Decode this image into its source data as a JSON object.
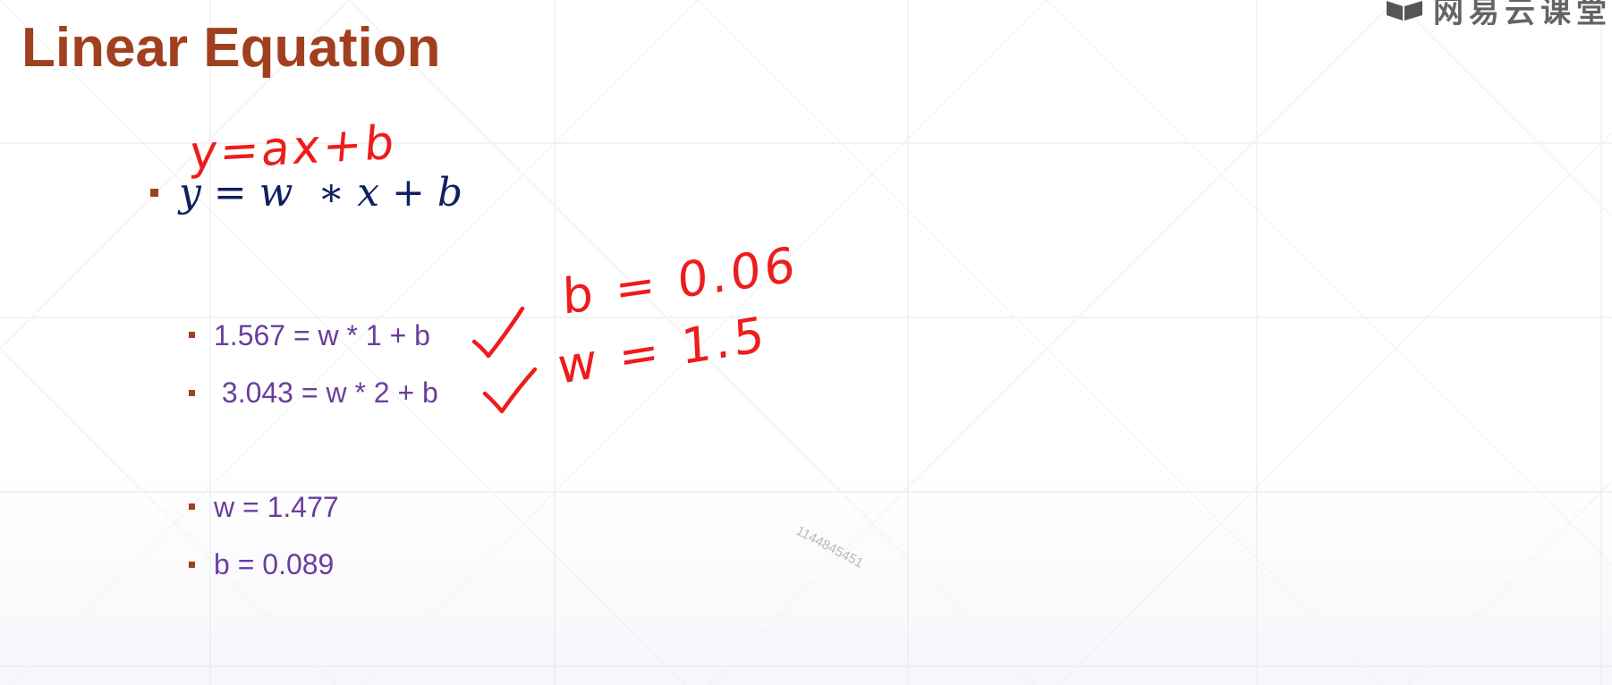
{
  "slide": {
    "title": "Linear Equation",
    "main_equation": "y = w  ∗ x + b",
    "items": [
      {
        "text": "1.567 = w * 1 + b"
      },
      {
        "text": " 3.043 = w * 2 + b"
      },
      {
        "text": "w = 1.477"
      },
      {
        "text": "b = 0.089"
      }
    ]
  },
  "annotations": {
    "handwritten_equation": "y=ax+b",
    "handwritten_b": "b = 0.06",
    "handwritten_w": "w = 1.5",
    "checkmark_count": 2
  },
  "overlay": {
    "watermark_id": "1144845451",
    "brand_name": "网易云课堂"
  },
  "colors": {
    "title": "#a0401f",
    "bullet": "#a0401f",
    "equation": "#0f2060",
    "item_text": "#6a3e9d",
    "ink": "#ee1c1c",
    "watermark": "#b9b9b9"
  }
}
